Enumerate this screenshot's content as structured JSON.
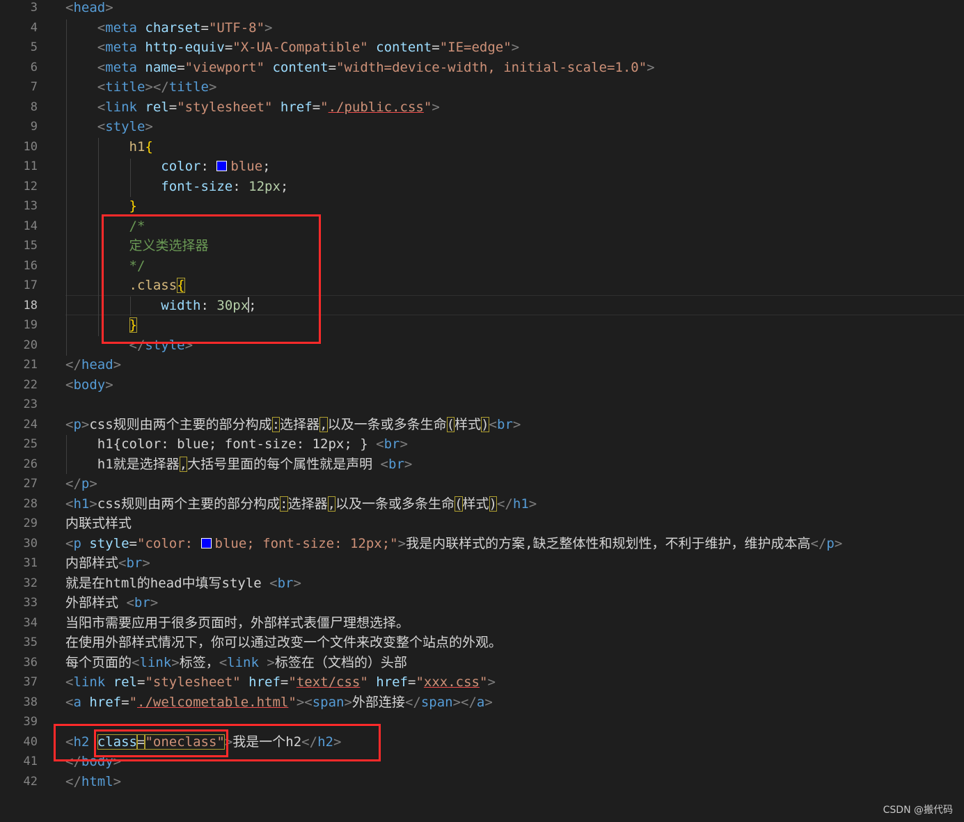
{
  "editor": {
    "language": "html",
    "current_line": 18,
    "watermark": "CSDN @搬代码",
    "annotation_color": "#ff2a2a",
    "lines": [
      {
        "n": "3",
        "tokens": [
          [
            "tg",
            "<"
          ],
          [
            "tn",
            "head"
          ],
          [
            "tg",
            ">"
          ]
        ]
      },
      {
        "n": "4",
        "tokens": [
          [
            "tx",
            "    "
          ],
          [
            "tg",
            "<"
          ],
          [
            "tn",
            "meta "
          ],
          [
            "at",
            "charset"
          ],
          [
            "tx",
            "="
          ],
          [
            "st",
            "\"UTF-8\""
          ],
          [
            "tg",
            ">"
          ]
        ]
      },
      {
        "n": "5",
        "tokens": [
          [
            "tx",
            "    "
          ],
          [
            "tg",
            "<"
          ],
          [
            "tn",
            "meta "
          ],
          [
            "at",
            "http-equiv"
          ],
          [
            "tx",
            "="
          ],
          [
            "st",
            "\"X-UA-Compatible\" "
          ],
          [
            "at",
            "content"
          ],
          [
            "tx",
            "="
          ],
          [
            "st",
            "\"IE=edge\""
          ],
          [
            "tg",
            ">"
          ]
        ]
      },
      {
        "n": "6",
        "tokens": [
          [
            "tx",
            "    "
          ],
          [
            "tg",
            "<"
          ],
          [
            "tn",
            "meta "
          ],
          [
            "at",
            "name"
          ],
          [
            "tx",
            "="
          ],
          [
            "st",
            "\"viewport\" "
          ],
          [
            "at",
            "content"
          ],
          [
            "tx",
            "="
          ],
          [
            "st",
            "\"width=device-width, initial-scale=1.0\""
          ],
          [
            "tg",
            ">"
          ]
        ]
      },
      {
        "n": "7",
        "tokens": [
          [
            "tx",
            "    "
          ],
          [
            "tg",
            "<"
          ],
          [
            "tn",
            "title"
          ],
          [
            "tg",
            "></"
          ],
          [
            "tn",
            "title"
          ],
          [
            "tg",
            ">"
          ]
        ]
      },
      {
        "n": "8",
        "tokens": [
          [
            "tx",
            "    "
          ],
          [
            "tg",
            "<"
          ],
          [
            "tn",
            "link "
          ],
          [
            "at",
            "rel"
          ],
          [
            "tx",
            "="
          ],
          [
            "st",
            "\"stylesheet\" "
          ],
          [
            "at",
            "href"
          ],
          [
            "tx",
            "="
          ],
          [
            "st",
            "\""
          ],
          [
            "st ul",
            "./public.css"
          ],
          [
            "st",
            "\""
          ],
          [
            "tg",
            ">"
          ]
        ]
      },
      {
        "n": "9",
        "tokens": [
          [
            "tx",
            "    "
          ],
          [
            "tg",
            "<"
          ],
          [
            "tn",
            "style"
          ],
          [
            "tg",
            ">"
          ]
        ]
      },
      {
        "n": "10",
        "tokens": [
          [
            "tx",
            "        "
          ],
          [
            "sel",
            "h1"
          ],
          [
            "bk",
            "{"
          ]
        ]
      },
      {
        "n": "11",
        "tokens": [
          [
            "tx",
            "            "
          ],
          [
            "pr",
            "color"
          ],
          [
            "tx",
            ": "
          ],
          [
            "sw",
            ""
          ],
          [
            "st",
            "blue"
          ],
          [
            "tx",
            ";"
          ]
        ]
      },
      {
        "n": "12",
        "tokens": [
          [
            "tx",
            "            "
          ],
          [
            "pr",
            "font-size"
          ],
          [
            "tx",
            ": "
          ],
          [
            "nm",
            "12px"
          ],
          [
            "tx",
            ";"
          ]
        ]
      },
      {
        "n": "13",
        "tokens": [
          [
            "tx",
            "        "
          ],
          [
            "bk",
            "}"
          ]
        ]
      },
      {
        "n": "14",
        "tokens": [
          [
            "tx",
            "        "
          ],
          [
            "cm",
            "/*"
          ]
        ]
      },
      {
        "n": "15",
        "tokens": [
          [
            "tx",
            "        "
          ],
          [
            "cm",
            "定义类选择器"
          ]
        ]
      },
      {
        "n": "16",
        "tokens": [
          [
            "tx",
            "        "
          ],
          [
            "cm",
            "*/"
          ]
        ]
      },
      {
        "n": "17",
        "tokens": [
          [
            "tx",
            "        "
          ],
          [
            "sel",
            ".class"
          ],
          [
            "bk hl",
            "{"
          ]
        ]
      },
      {
        "n": "18",
        "tokens": [
          [
            "tx",
            "            "
          ],
          [
            "pr",
            "width"
          ],
          [
            "tx",
            ": "
          ],
          [
            "nm",
            "30px"
          ],
          [
            "cursor",
            ""
          ],
          [
            "tx",
            ";"
          ]
        ]
      },
      {
        "n": "19",
        "tokens": [
          [
            "tx",
            "        "
          ],
          [
            "bk hl",
            "}"
          ]
        ]
      },
      {
        "n": "20",
        "tokens": [
          [
            "tx",
            "        "
          ],
          [
            "tg",
            "</"
          ],
          [
            "tn",
            "style"
          ],
          [
            "tg",
            ">"
          ]
        ]
      },
      {
        "n": "21",
        "tokens": [
          [
            "tg",
            "</"
          ],
          [
            "tn",
            "head"
          ],
          [
            "tg",
            ">"
          ]
        ]
      },
      {
        "n": "22",
        "tokens": [
          [
            "tg",
            "<"
          ],
          [
            "tn",
            "body"
          ],
          [
            "tg",
            ">"
          ]
        ]
      },
      {
        "n": "23",
        "tokens": []
      },
      {
        "n": "24",
        "tokens": [
          [
            "tg",
            "<"
          ],
          [
            "tn",
            "p"
          ],
          [
            "tg",
            ">"
          ],
          [
            "tx",
            "css规则由两个主要的部分构成"
          ],
          [
            "tx hl",
            ":"
          ],
          [
            "tx",
            "选择器"
          ],
          [
            "tx hl",
            ","
          ],
          [
            "tx",
            "以及一条或多条生命"
          ],
          [
            "tx hl",
            "("
          ],
          [
            "tx",
            "样式"
          ],
          [
            "tx hl",
            ")"
          ],
          [
            "tg",
            "<"
          ],
          [
            "tn",
            "br"
          ],
          [
            "tg",
            ">"
          ]
        ]
      },
      {
        "n": "25",
        "tokens": [
          [
            "tx",
            "    h1{color: blue; font-size: 12px; } "
          ],
          [
            "tg",
            "<"
          ],
          [
            "tn",
            "br"
          ],
          [
            "tg",
            ">"
          ]
        ]
      },
      {
        "n": "26",
        "tokens": [
          [
            "tx",
            "    h1就是选择器"
          ],
          [
            "tx hl",
            ","
          ],
          [
            "tx",
            "大括号里面的每个属性就是声明 "
          ],
          [
            "tg",
            "<"
          ],
          [
            "tn",
            "br"
          ],
          [
            "tg",
            ">"
          ]
        ]
      },
      {
        "n": "27",
        "tokens": [
          [
            "tg",
            "</"
          ],
          [
            "tn",
            "p"
          ],
          [
            "tg",
            ">"
          ]
        ]
      },
      {
        "n": "28",
        "tokens": [
          [
            "tg",
            "<"
          ],
          [
            "tn",
            "h1"
          ],
          [
            "tg",
            ">"
          ],
          [
            "tx",
            "css规则由两个主要的部分构成"
          ],
          [
            "tx hl",
            ":"
          ],
          [
            "tx",
            "选择器"
          ],
          [
            "tx hl",
            ","
          ],
          [
            "tx",
            "以及一条或多条生命"
          ],
          [
            "tx hl",
            "("
          ],
          [
            "tx",
            "样式"
          ],
          [
            "tx hl",
            ")"
          ],
          [
            "tg",
            "</"
          ],
          [
            "tn",
            "h1"
          ],
          [
            "tg",
            ">"
          ]
        ]
      },
      {
        "n": "29",
        "tokens": [
          [
            "tx",
            "内联式样式"
          ]
        ]
      },
      {
        "n": "30",
        "tokens": [
          [
            "tg",
            "<"
          ],
          [
            "tn",
            "p "
          ],
          [
            "at",
            "style"
          ],
          [
            "tx",
            "="
          ],
          [
            "st",
            "\"color: "
          ],
          [
            "sw",
            ""
          ],
          [
            "st",
            "blue; font-size: 12px;\""
          ],
          [
            "tg",
            ">"
          ],
          [
            "tx",
            "我是内联样式的方案,缺乏整体性和规划性，不利于维护，维护成本高"
          ],
          [
            "tg",
            "</"
          ],
          [
            "tn",
            "p"
          ],
          [
            "tg",
            ">"
          ]
        ]
      },
      {
        "n": "31",
        "tokens": [
          [
            "tx",
            "内部样式"
          ],
          [
            "tg",
            "<"
          ],
          [
            "tn",
            "br"
          ],
          [
            "tg",
            ">"
          ]
        ]
      },
      {
        "n": "32",
        "tokens": [
          [
            "tx",
            "就是在html的head中填写style "
          ],
          [
            "tg",
            "<"
          ],
          [
            "tn",
            "br"
          ],
          [
            "tg",
            ">"
          ]
        ]
      },
      {
        "n": "33",
        "tokens": [
          [
            "tx",
            "外部样式 "
          ],
          [
            "tg",
            "<"
          ],
          [
            "tn",
            "br"
          ],
          [
            "tg",
            ">"
          ]
        ]
      },
      {
        "n": "34",
        "tokens": [
          [
            "tx",
            "当阳市需要应用于很多页面时，外部样式表僵尸理想选择。"
          ]
        ]
      },
      {
        "n": "35",
        "tokens": [
          [
            "tx",
            "在使用外部样式情况下，你可以通过改变一个文件来改变整个站点的外观。"
          ]
        ]
      },
      {
        "n": "36",
        "tokens": [
          [
            "tx",
            "每个页面的"
          ],
          [
            "tg",
            "<"
          ],
          [
            "tn",
            "link"
          ],
          [
            "tg",
            ">"
          ],
          [
            "tx",
            "标签，"
          ],
          [
            "tg",
            "<"
          ],
          [
            "tn",
            "link "
          ],
          [
            "tg",
            ">"
          ],
          [
            "tx",
            "标签在（文档的）头部"
          ]
        ]
      },
      {
        "n": "37",
        "tokens": [
          [
            "tg",
            "<"
          ],
          [
            "tn",
            "link "
          ],
          [
            "at",
            "rel"
          ],
          [
            "tx",
            "="
          ],
          [
            "st",
            "\"stylesheet\" "
          ],
          [
            "at",
            "href"
          ],
          [
            "tx",
            "="
          ],
          [
            "st",
            "\""
          ],
          [
            "st ul",
            "text/css"
          ],
          [
            "st",
            "\" "
          ],
          [
            "at",
            "href"
          ],
          [
            "tx",
            "="
          ],
          [
            "st",
            "\""
          ],
          [
            "st ul",
            "xxx.css"
          ],
          [
            "st",
            "\""
          ],
          [
            "tg",
            ">"
          ]
        ]
      },
      {
        "n": "38",
        "tokens": [
          [
            "tg",
            "<"
          ],
          [
            "tn",
            "a "
          ],
          [
            "at",
            "href"
          ],
          [
            "tx",
            "="
          ],
          [
            "st",
            "\""
          ],
          [
            "st ul",
            "./welcometable.html"
          ],
          [
            "st",
            "\""
          ],
          [
            "tg",
            "><"
          ],
          [
            "tn",
            "span"
          ],
          [
            "tg",
            ">"
          ],
          [
            "tx",
            "外部连接"
          ],
          [
            "tg",
            "</"
          ],
          [
            "tn",
            "span"
          ],
          [
            "tg",
            "></"
          ],
          [
            "tn",
            "a"
          ],
          [
            "tg",
            ">"
          ]
        ]
      },
      {
        "n": "39",
        "tokens": []
      },
      {
        "n": "40",
        "tokens": [
          [
            "tg",
            "<"
          ],
          [
            "tn",
            "h2 "
          ],
          [
            "at hl",
            "class"
          ],
          [
            "tx hl",
            "="
          ],
          [
            "st hl",
            "\"oneclass\""
          ],
          [
            "tg",
            ">"
          ],
          [
            "tx",
            "我是一个h2"
          ],
          [
            "tg",
            "</"
          ],
          [
            "tn",
            "h2"
          ],
          [
            "tg",
            ">"
          ]
        ]
      },
      {
        "n": "41",
        "tokens": [
          [
            "tg",
            "</"
          ],
          [
            "tn",
            "body"
          ],
          [
            "tg",
            ">"
          ]
        ]
      },
      {
        "n": "42",
        "tokens": [
          [
            "tg",
            "</"
          ],
          [
            "tn",
            "html"
          ],
          [
            "tg",
            ">"
          ]
        ]
      }
    ]
  }
}
